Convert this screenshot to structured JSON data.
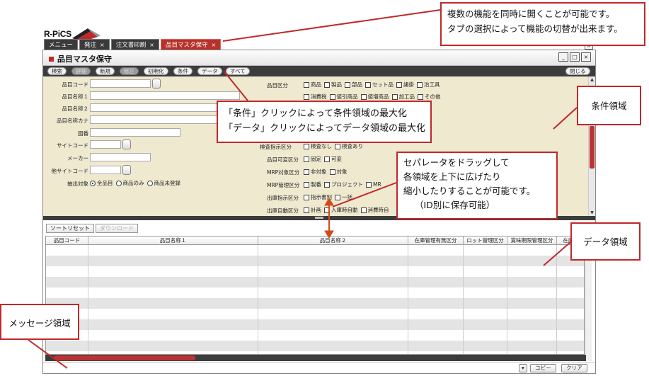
{
  "app": {
    "logo_text": "R-PiCS"
  },
  "tabs": [
    {
      "label": "メニュー",
      "closable": false,
      "active": false
    },
    {
      "label": "発注",
      "closable": true,
      "active": false
    },
    {
      "label": "注文書印刷",
      "closable": true,
      "active": false
    },
    {
      "label": "品目マスタ保守",
      "closable": true,
      "active": true
    }
  ],
  "close_glyph": "×",
  "window": {
    "title": "品目マスタ保守",
    "controls": {
      "minimize": "_",
      "restore": "□",
      "close": "×"
    }
  },
  "toolbar": {
    "search": "検索",
    "detail": "詳細",
    "new": "新規",
    "edit": "修正",
    "init": "初期化",
    "condition": "条件",
    "data": "データ",
    "all": "すべて",
    "close": "閉じる"
  },
  "fields": {
    "item_code": "品目コード",
    "item_name1": "品目名称１",
    "item_name2": "品目名称２",
    "item_kana": "品目名称カナ",
    "drawing": "図番",
    "site_code": "サイトコード",
    "maker": "メーカー",
    "other_site": "他サイトコード",
    "target": "抽出対象"
  },
  "extract_options": [
    {
      "label": "全品目",
      "selected": true
    },
    {
      "label": "商品のみ",
      "selected": false
    },
    {
      "label": "商品未登録",
      "selected": false
    }
  ],
  "right_fields": {
    "item_class": {
      "label": "品目区分",
      "options": [
        "商品",
        "製品",
        "部品",
        "セット品",
        "諸掛",
        "治工具"
      ]
    },
    "item_class_2": {
      "options": [
        "消費税",
        "値引商品",
        "値増商品",
        "加工品",
        "その他"
      ]
    },
    "inspection": {
      "label": "検査指示区分",
      "options": [
        "検査なし",
        "検査あり"
      ]
    },
    "variable": {
      "label": "品目可変区分",
      "options": [
        "固定",
        "可変"
      ]
    },
    "mrp_target": {
      "label": "MRP対象区分",
      "options": [
        "非対象",
        "対象"
      ]
    },
    "mrp_manage": {
      "label": "MRP管理区分",
      "options": [
        "製番",
        "プロジェクト",
        "MR"
      ]
    },
    "ship_instr": {
      "label": "出庫指示区分",
      "options": [
        "指示書別",
        "一括"
      ]
    },
    "ship_auto": {
      "label": "出庫自動区分",
      "options": [
        "計画",
        "入庫時自動",
        "消費時自"
      ]
    }
  },
  "data_toolbar": {
    "sort_reset": "ソートリセット",
    "download": "ダウンロード"
  },
  "grid": {
    "columns": [
      "品目コード",
      "品目名称１",
      "品目名称２",
      "在庫管理有無区分",
      "ロット管理区分",
      "賞味期限管理区分",
      "在庫単"
    ],
    "row_count": 10
  },
  "message_bar": {
    "dropdown": "▾",
    "copy": "コピー",
    "clear": "クリア"
  },
  "annotations": {
    "tabs_note": [
      "複数の機能を同時に開くことが可能です。",
      "タブの選択によって機能の切替が出来ます。"
    ],
    "maximize_note": [
      "「条件」クリックによって条件領域の最大化",
      "「データ」クリックによってデータ領域の最大化"
    ],
    "condition_area": "条件領域",
    "separator_note": [
      "セパレータをドラッグして",
      "各領域を上下に広げたり",
      "縮小したりすることが可能です。",
      "（ID別に保存可能）"
    ],
    "data_area": "データ領域",
    "message_area": "メッセージ領域"
  },
  "colors": {
    "accent": "#c0282a",
    "toolbar_bg": "#3c3c3c",
    "condition_bg": "#efe9d0",
    "tab_active": "#b8312b"
  }
}
